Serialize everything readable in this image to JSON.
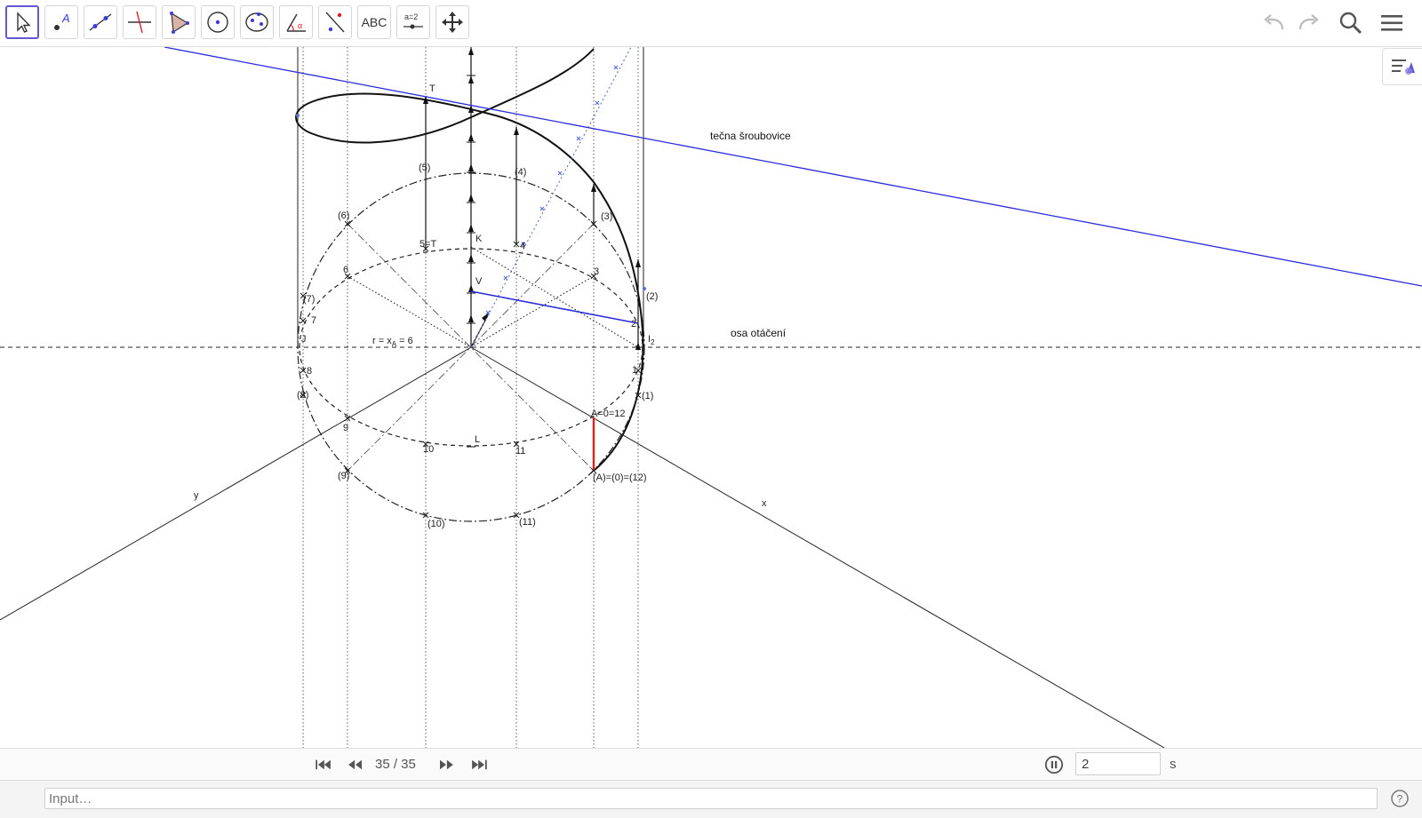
{
  "toolbar": {
    "tools": [
      {
        "name": "move-tool",
        "label": ""
      },
      {
        "name": "point-tool",
        "label": "A"
      },
      {
        "name": "line-tool",
        "label": ""
      },
      {
        "name": "perpendicular-line-tool",
        "label": ""
      },
      {
        "name": "polygon-tool",
        "label": ""
      },
      {
        "name": "circle-tool",
        "label": ""
      },
      {
        "name": "conic-tool",
        "label": ""
      },
      {
        "name": "angle-tool",
        "label": "α"
      },
      {
        "name": "reflect-tool",
        "label": ""
      },
      {
        "name": "text-tool",
        "label": "ABC"
      },
      {
        "name": "slider-tool",
        "label": "a=2"
      },
      {
        "name": "move-graphics-view-tool",
        "label": ""
      }
    ],
    "right_icons": [
      "undo-icon",
      "redo-icon",
      "search-icon",
      "menu-icon"
    ]
  },
  "graphics": {
    "labels": {
      "T": "T",
      "five_paren": "(5)",
      "four_paren": "(4)",
      "three_paren": "(3)",
      "six_paren": "(6)",
      "two_paren": "(2)",
      "seven_paren": "(7)",
      "eight_paren": "(8)",
      "one_paren": "(1)",
      "nine_paren": "(9)",
      "ten_paren": "(10)",
      "eleven_paren": "(11)",
      "five_eq_T": "5=T",
      "K": "K",
      "four": "4",
      "three": "3",
      "six": "6",
      "V": "V",
      "two": "2",
      "seven": "7",
      "J": "J",
      "r_label_main": "r = x",
      "r_label_sub": "A",
      "r_label_end": " = 6",
      "I2": "I",
      "I2_sub": "2",
      "one": "1",
      "eight": "8",
      "A_label": "A=0=12",
      "nine": "9",
      "ten": "10",
      "L": "L",
      "eleven": "11",
      "A_paren": "(A)=(0)=(12)",
      "y_axis": "y",
      "x_axis": "x",
      "tangent_text": "tečna šroubovice",
      "axis_text": "osa otáčení"
    }
  },
  "playbar": {
    "step": "35 / 35",
    "speed_value": "2",
    "speed_unit": "s"
  },
  "inputbar": {
    "placeholder": "Input…"
  },
  "colors": {
    "accent": "#6557d2",
    "blue_line": "#2b2bdb",
    "red_segment": "#e02020",
    "point_blue": "#5a6ed8"
  }
}
